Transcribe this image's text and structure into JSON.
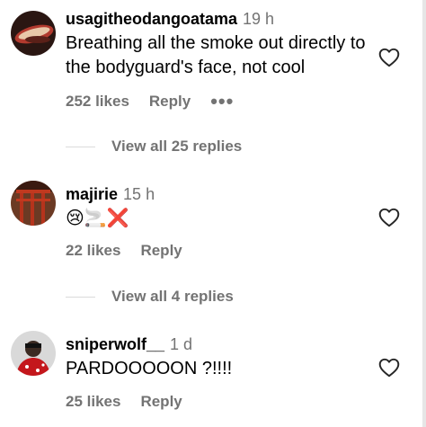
{
  "comments": [
    {
      "username": "usagitheodangoatama",
      "time": "19 h",
      "text": "Breathing all the smoke out directly to the bodyguard's face, not cool",
      "likes": "252 likes",
      "reply": "Reply",
      "more": "•••",
      "view_replies": "View all 25 replies"
    },
    {
      "username": "majirie",
      "time": "15 h",
      "text": "😢🚬❌",
      "likes": "22 likes",
      "reply": "Reply",
      "view_replies": "View all 4 replies"
    },
    {
      "username": "sniperwolf__",
      "time": "1 d",
      "text": "PARDOOOOON ?!!!!",
      "likes": "25 likes",
      "reply": "Reply"
    }
  ]
}
